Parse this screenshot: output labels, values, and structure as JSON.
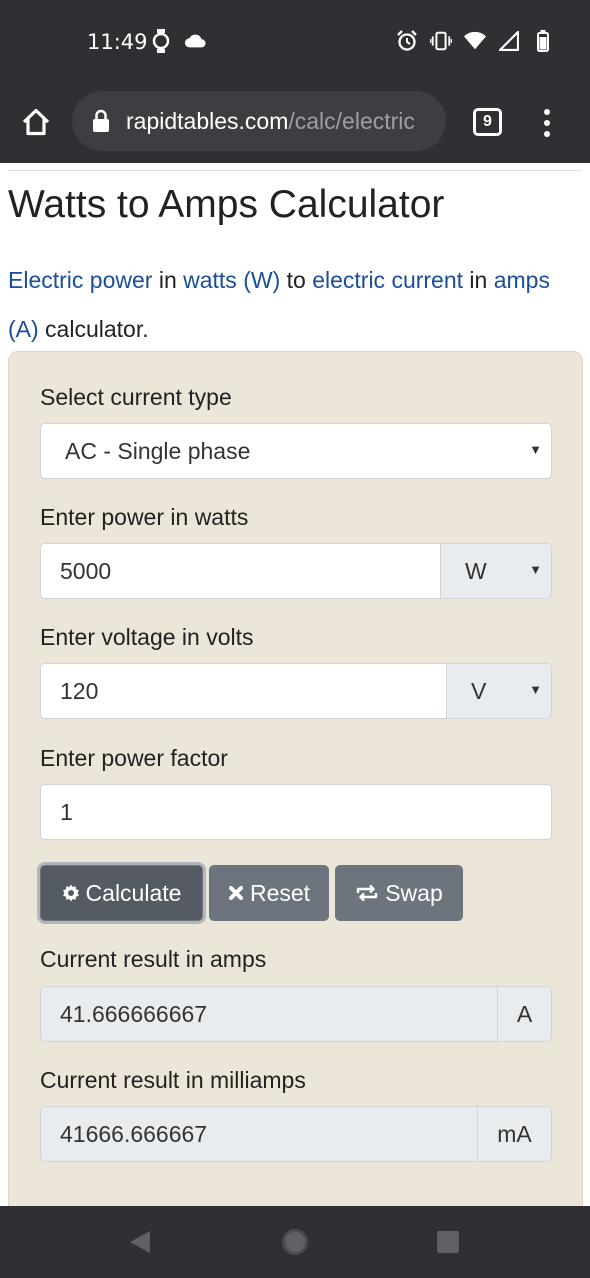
{
  "status_bar": {
    "time": "11:49",
    "left_icons": [
      "watch-icon",
      "cloud-icon"
    ],
    "right_icons": [
      "alarm-icon",
      "vibrate-icon",
      "wifi-icon",
      "signal-icon",
      "battery-icon"
    ]
  },
  "browser": {
    "url_host": "rapidtables.com",
    "url_path": "/calc/electric",
    "tab_count": "9"
  },
  "page": {
    "title": "Watts to Amps Calculator",
    "intro": {
      "link1": "Electric power",
      "t1": " in ",
      "link2": "watts (W)",
      "t2": " to ",
      "link3": "electric current",
      "t3": " in ",
      "link4": "amps (A)",
      "t4": " calculator."
    }
  },
  "calculator": {
    "current_type_label": "Select current type",
    "current_type_value": "AC - Single phase",
    "power_label": "Enter power in watts",
    "power_value": "5000",
    "power_unit": "W",
    "voltage_label": "Enter voltage in volts",
    "voltage_value": "120",
    "voltage_unit": "V",
    "pf_label": "Enter power factor",
    "pf_value": "1",
    "buttons": {
      "calculate": "Calculate",
      "reset": "Reset",
      "swap": "Swap"
    },
    "amps_label": "Current result in amps",
    "amps_value": "41.666666667",
    "amps_unit": "A",
    "milliamps_label": "Current result in milliamps",
    "milliamps_value": "41666.666667",
    "milliamps_unit": "mA"
  },
  "colors": {
    "link": "#1a4d9c",
    "calc_bg": "#ece6d8",
    "button": "#6c757d",
    "system_bar": "#2f3033"
  }
}
